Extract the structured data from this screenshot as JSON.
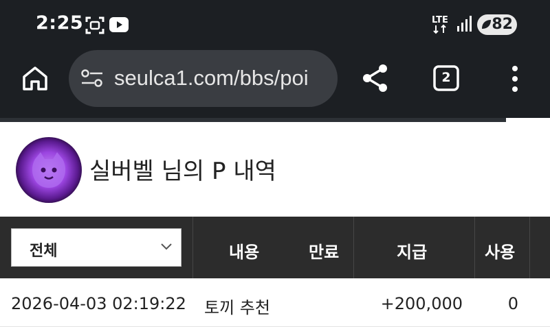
{
  "status": {
    "time": "2:25",
    "network": "LTE",
    "battery": "82",
    "icons": [
      "screenshot-icon",
      "youtube-icon",
      "lte-icon",
      "signal-icon",
      "battery-icon"
    ]
  },
  "browser": {
    "url": "seulca1.com/bbs/poi",
    "tab_count": "2",
    "icons": [
      "home-icon",
      "site-settings-icon",
      "share-icon",
      "tabs-icon",
      "more-vert-icon"
    ],
    "load_progress": 0.92
  },
  "profile": {
    "title": "실버벨 님의 P 내역",
    "avatar": "purple-mascot-avatar"
  },
  "table": {
    "filter": {
      "selected": "전체"
    },
    "headers": {
      "content": "내용",
      "expire": "만료",
      "pay": "지급",
      "use": "사용"
    },
    "rows": [
      {
        "date": "2026-04-03 02:19:22",
        "content": "토끼 추천",
        "expire": "",
        "pay": "+200,000",
        "use": "0"
      }
    ]
  },
  "colors": {
    "chrome_bg": "#1c1f23",
    "url_pill": "#3a3d42",
    "table_header": "#2c2c2c",
    "avatar_glow": "#9b45e0"
  }
}
